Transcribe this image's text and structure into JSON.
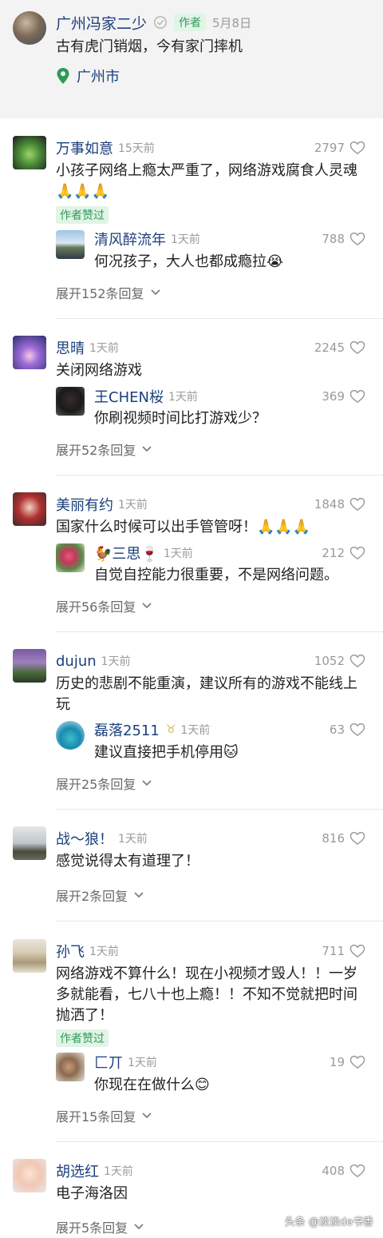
{
  "post": {
    "author": "广州冯家二少",
    "author_tag": "作者",
    "date": "5月8日",
    "text": "古有虎门销烟，今有家门摔机",
    "location": "广州市"
  },
  "ui": {
    "author_liked_label": "作者赞过"
  },
  "comments": [
    {
      "user": "万事如意",
      "time": "15天前",
      "likes": "2797",
      "text": "小孩子网络上瘾太严重了，网络游戏腐食人灵魂🙏🙏🙏",
      "author_liked": true,
      "reply": {
        "user": "清风醉流年",
        "time": "1天前",
        "likes": "788",
        "text": "何况孩子，大人也都成瘾拉😭"
      },
      "expand": "展开152条回复"
    },
    {
      "user": "思晴",
      "time": "1天前",
      "likes": "2245",
      "text": "关闭网络游戏",
      "reply": {
        "user": "王CHEN桜",
        "time": "1天前",
        "likes": "369",
        "text": "你刷视频时间比打游戏少？"
      },
      "expand": "展开52条回复"
    },
    {
      "user": "美丽有约",
      "time": "1天前",
      "likes": "1848",
      "text": "国家什么时候可以出手管管呀！🙏🙏🙏",
      "reply": {
        "user": "🐓三思🍷",
        "time": "1天前",
        "likes": "212",
        "text": "自觉自控能力很重要，不是网络问题。"
      },
      "expand": "展开56条回复"
    },
    {
      "user": "dujun",
      "time": "1天前",
      "likes": "1052",
      "text": "历史的悲剧不能重演，建议所有的游戏不能线上玩",
      "reply": {
        "user": "磊落2511",
        "badge": "♉",
        "time": "1天前",
        "likes": "63",
        "text": "建议直接把手机停用🐱"
      },
      "expand": "展开25条回复"
    },
    {
      "user": "战～狼！",
      "time": "1天前",
      "likes": "816",
      "text": "感觉说得太有道理了！",
      "expand": "展开2条回复"
    },
    {
      "user": "孙飞",
      "time": "1天前",
      "likes": "711",
      "text": "网络游戏不算什么！现在小视频才毁人！！一岁多就能看，七八十也上瘾！！不知不觉就把时间抛洒了！",
      "author_liked": true,
      "reply": {
        "user": "匚丌",
        "time": "1天前",
        "likes": "19",
        "text": "你现在在做什么😊"
      },
      "expand": "展开15条回复"
    },
    {
      "user": "胡选红",
      "time": "1天前",
      "likes": "408",
      "text": "电子海洛因",
      "expand": "展开5条回复"
    }
  ],
  "watermark": "头条 @淡淡de书香",
  "colors": {
    "username": "#1c3f7c",
    "green": "#2f9a57",
    "muted": "#9a9a9a"
  }
}
